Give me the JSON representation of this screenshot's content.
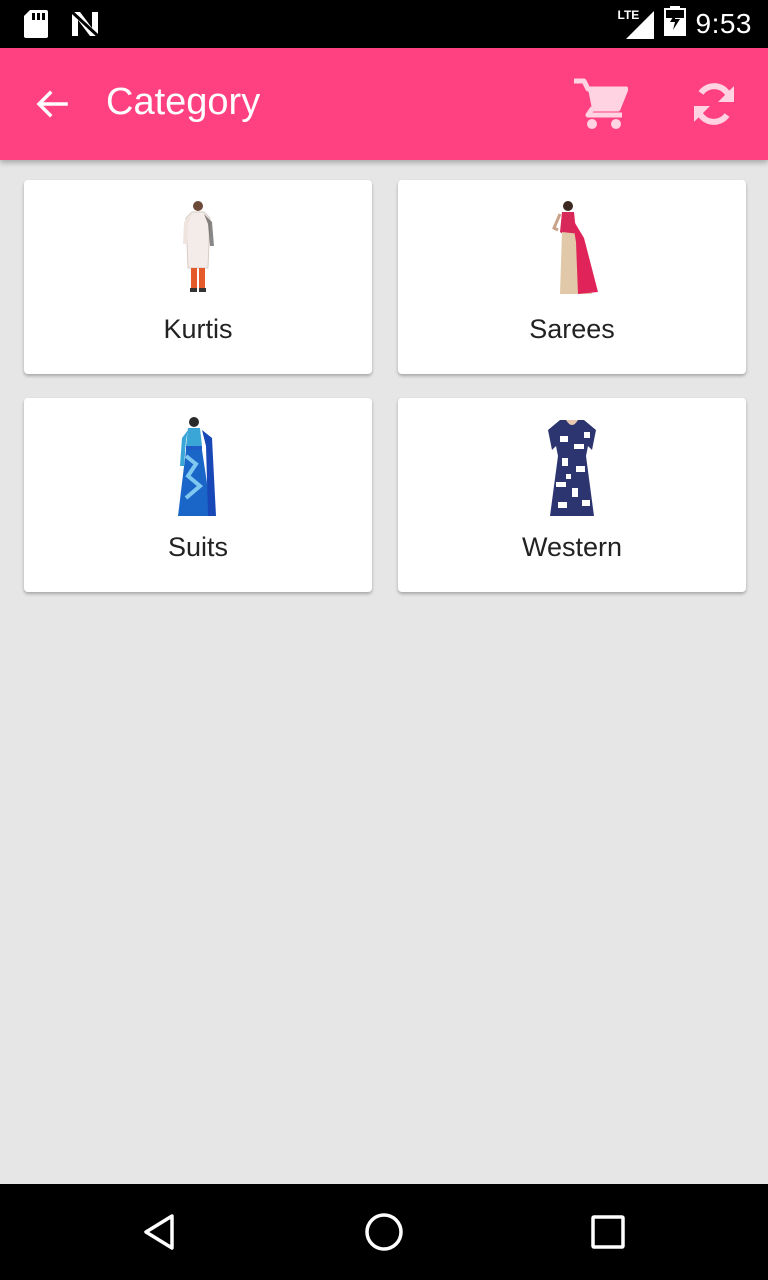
{
  "status_bar": {
    "time": "9:53",
    "network": "LTE",
    "icons": [
      "sd-card-icon",
      "n-notification-icon",
      "signal-icon",
      "battery-icon"
    ]
  },
  "app_bar": {
    "title": "Category",
    "background_color": "#ff4081",
    "actions": [
      "back-arrow-icon",
      "cart-icon",
      "refresh-icon"
    ]
  },
  "categories": [
    {
      "label": "Kurtis",
      "image": "kurti-product-image"
    },
    {
      "label": "Sarees",
      "image": "saree-product-image"
    },
    {
      "label": "Suits",
      "image": "suit-product-image"
    },
    {
      "label": "Western",
      "image": "western-dress-product-image"
    }
  ],
  "nav_bar": {
    "buttons": [
      "back-triangle-icon",
      "home-circle-icon",
      "recents-square-icon"
    ]
  }
}
